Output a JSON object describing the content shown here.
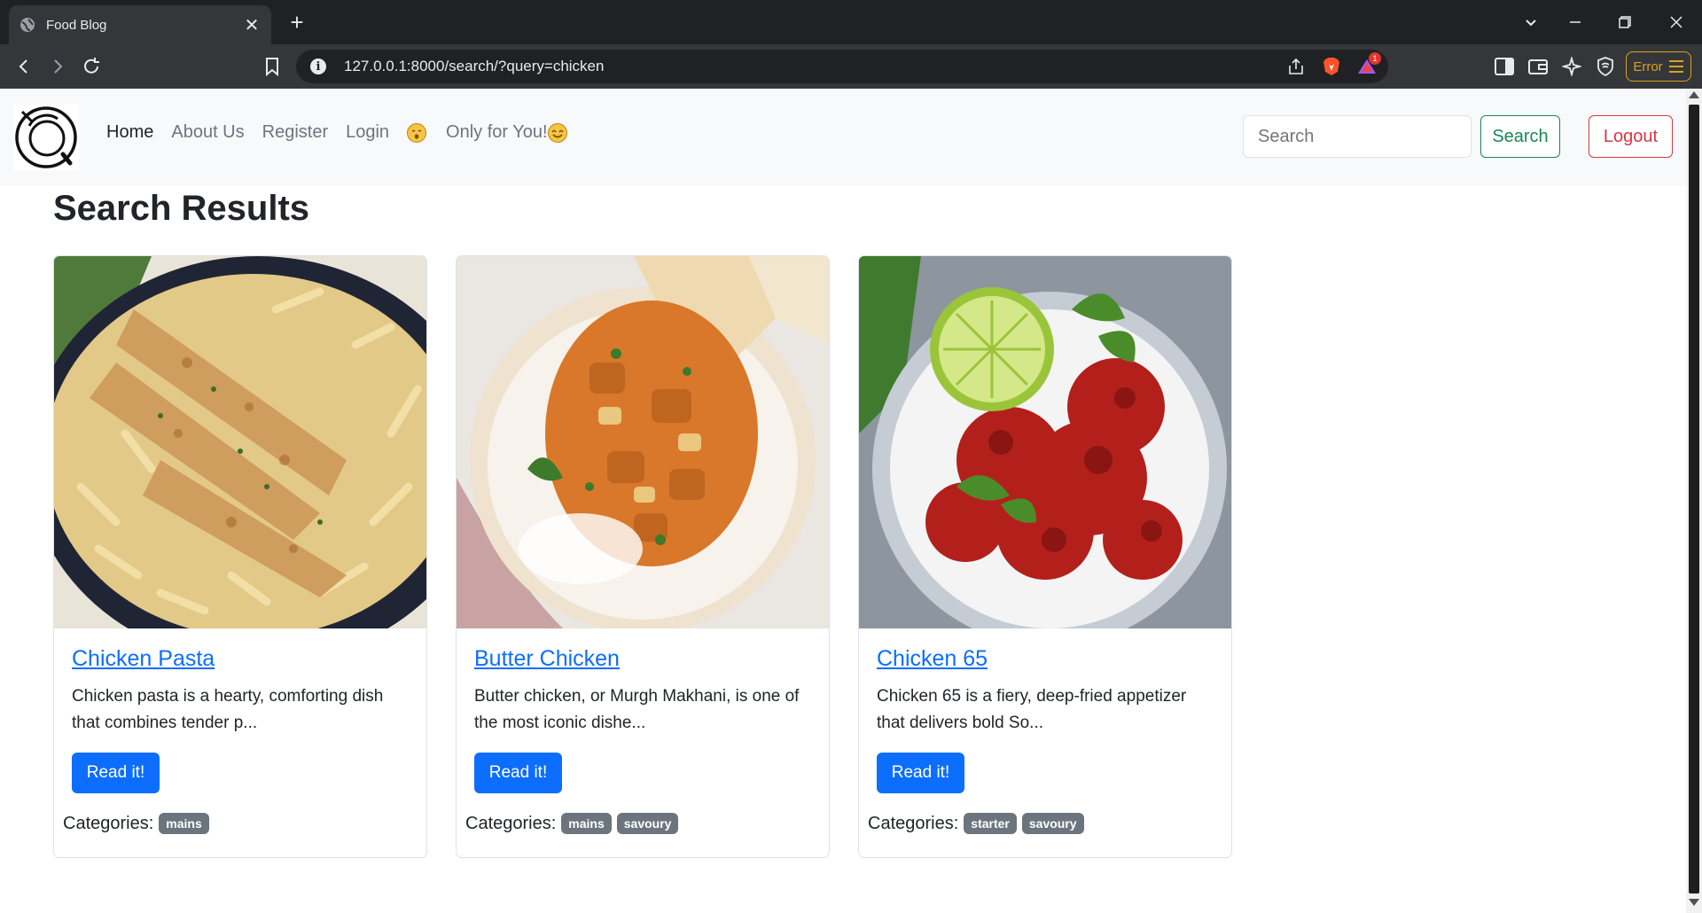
{
  "browser": {
    "tab_title": "Food Blog",
    "url": "127.0.0.1:8000/search/?query=chicken",
    "error_label": "Error",
    "notification_count": "1"
  },
  "navbar": {
    "links": [
      "Home",
      "About Us",
      "Register",
      "Login"
    ],
    "special_link": "Only for You!",
    "search_placeholder": "Search",
    "search_button": "Search",
    "logout_button": "Logout"
  },
  "page_title": "Search Results",
  "cards": [
    {
      "title": "Chicken Pasta",
      "text": "Chicken pasta is a hearty, comforting dish that combines tender p...",
      "button": "Read it!",
      "categories_label": "Categories:",
      "categories": [
        "mains"
      ]
    },
    {
      "title": "Butter Chicken",
      "text": "Butter chicken, or Murgh Makhani, is one of the most iconic dishe...",
      "button": "Read it!",
      "categories_label": "Categories:",
      "categories": [
        "mains",
        "savoury"
      ]
    },
    {
      "title": "Chicken 65",
      "text": "Chicken 65 is a fiery, deep-fried appetizer that delivers bold So...",
      "button": "Read it!",
      "categories_label": "Categories:",
      "categories": [
        "starter",
        "savoury"
      ]
    }
  ],
  "colors": {
    "primary": "#0d6efd",
    "success": "#198754",
    "danger": "#dc3545",
    "badge": "#6c757d"
  }
}
